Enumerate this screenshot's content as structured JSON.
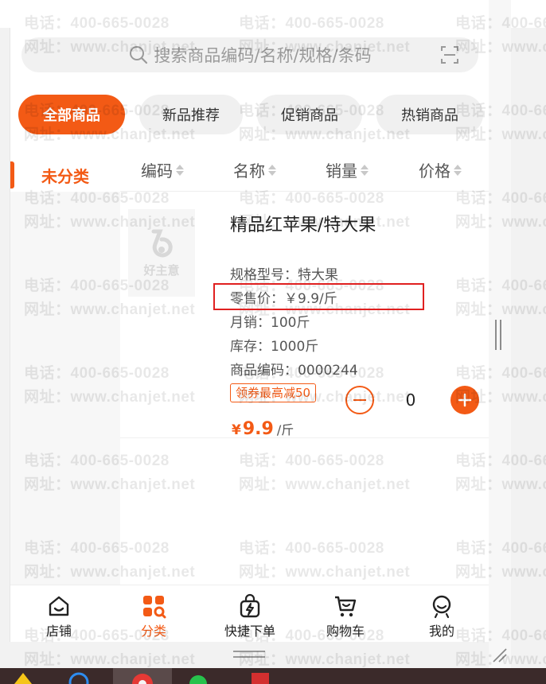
{
  "watermark": {
    "phone_line": "电话：400-665-0028",
    "site_line": "网址：www.chanjet.net"
  },
  "search": {
    "placeholder": "搜索商品编码/名称/规格/条码",
    "icon": "search-icon",
    "scan_icon": "scan-icon"
  },
  "category_chips": [
    {
      "label": "全部商品",
      "active": true
    },
    {
      "label": "新品推荐",
      "active": false
    },
    {
      "label": "促销商品",
      "active": false
    },
    {
      "label": "热销商品",
      "active": false
    }
  ],
  "left_category": {
    "label": "未分类",
    "active": true
  },
  "sort_headers": [
    {
      "label": "编码"
    },
    {
      "label": "名称"
    },
    {
      "label": "销量"
    },
    {
      "label": "价格"
    }
  ],
  "product": {
    "name": "精品红苹果/特大果",
    "thumb_placeholder": "好主意",
    "spec": "规格型号：特大果",
    "retail_price": "零售价：￥9.9/斤",
    "monthly_sales": "月销：100斤",
    "stock": "库存：1000斤",
    "code": "商品编码：0000244",
    "coupon": "领券最高减50",
    "price_symbol": "¥",
    "price_value": "9.9",
    "price_unit": "/斤",
    "quantity": "0"
  },
  "bottom_nav": [
    {
      "label": "店铺",
      "icon": "store-icon",
      "active": false
    },
    {
      "label": "分类",
      "icon": "category-icon",
      "active": true
    },
    {
      "label": "快捷下单",
      "icon": "quick-order-icon",
      "active": false
    },
    {
      "label": "购物车",
      "icon": "cart-icon",
      "active": false
    },
    {
      "label": "我的",
      "icon": "profile-icon",
      "active": false
    }
  ],
  "colors": {
    "accent": "#f35a15",
    "highlight_box": "#e02020",
    "taskbar": "#3b2a2a"
  }
}
